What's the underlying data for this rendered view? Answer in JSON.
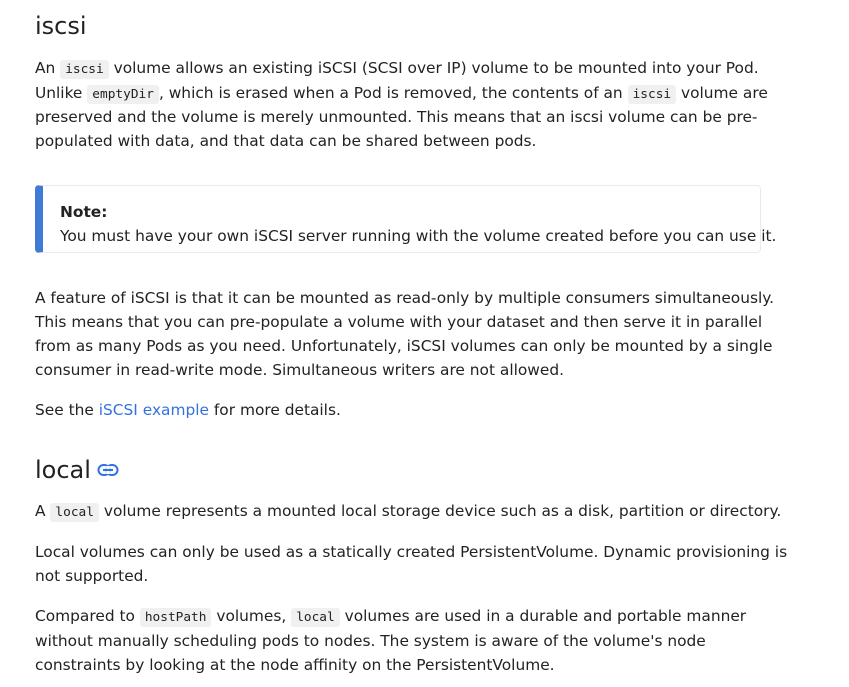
{
  "iscsi": {
    "heading": "iscsi",
    "para1": {
      "l1_a": "An ",
      "l1_code": "iscsi",
      "l1_b": " volume allows an existing iSCSI (SCSI over IP) volume to be mounted into your Pod.",
      "l2_a": "Unlike ",
      "l2_code": "emptyDir",
      "l2_b": ", which is erased when a Pod is removed, the contents of an ",
      "l2_code2": "iscsi",
      "l2_c": " volume are",
      "l3": "preserved and the volume is merely unmounted. This means that an iscsi volume can be pre-",
      "l4": "populated with data, and that data can be shared between pods."
    },
    "note": {
      "title": "Note:",
      "body": "You must have your own iSCSI server running with the volume created before you can use it."
    },
    "para2": {
      "l1": "A feature of iSCSI is that it can be mounted as read-only by multiple consumers simultaneously.",
      "l2": "This means that you can pre-populate a volume with your dataset and then serve it in parallel",
      "l3": "from as many Pods as you need. Unfortunately, iSCSI volumes can only be mounted by a single",
      "l4": "consumer in read-write mode. Simultaneous writers are not allowed."
    },
    "para3": {
      "before": "See the ",
      "link": "iSCSI example",
      "after": " for more details."
    }
  },
  "local": {
    "heading": "local",
    "anchor_icon": "link-icon",
    "para1": {
      "a": "A ",
      "code": "local",
      "b": " volume represents a mounted local storage device such as a disk, partition or directory."
    },
    "para2": {
      "l1": "Local volumes can only be used as a statically created PersistentVolume. Dynamic provisioning is",
      "l2": "not supported."
    },
    "para3": {
      "l1_a": "Compared to ",
      "l1_code": "hostPath",
      "l1_b": " volumes, ",
      "l1_code2": "local",
      "l1_c": " volumes are used in a durable and portable manner",
      "l2": "without manually scheduling pods to nodes. The system is aware of the volume's node",
      "l3": "constraints by looking at the node affinity on the PersistentVolume."
    }
  },
  "colors": {
    "link": "#3371e3",
    "note_border": "#3f7ad4",
    "code_bg": "#f0f0f0",
    "text": "#222222"
  }
}
